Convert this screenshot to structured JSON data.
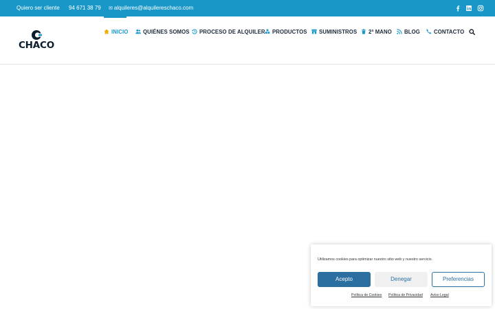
{
  "topbar": {
    "client_link": "Quiero ser cliente",
    "phone_icon": "",
    "phone": "94 671 38 79",
    "email_icon": "✉",
    "email": "alquileres@alquilereschaco.com",
    "social": [
      "facebook-icon",
      "linkedin-icon",
      "instagram-icon"
    ]
  },
  "brand": {
    "logo_text": "CHACO"
  },
  "nav": {
    "items": [
      {
        "label": "INICIO",
        "icon": "home-icon",
        "active": true
      },
      {
        "label": "QUIÉNES SOMOS",
        "icon": "users-icon"
      },
      {
        "label": "PROCESO DE ALQUILER",
        "icon": "history-icon"
      },
      {
        "label": "PRODUCTOS",
        "icon": "cubes-icon"
      },
      {
        "label": "SUMINISTROS",
        "icon": "store-icon"
      },
      {
        "label": "2ª MANO",
        "icon": "trash-icon"
      },
      {
        "label": "BLOG",
        "icon": "rss-icon"
      },
      {
        "label": "CONTACTO",
        "icon": "phone-icon"
      }
    ]
  },
  "cookie_banner": {
    "message": "Utilizamos cookies para optimizar nuestro sitio web y nuestro servicio.",
    "accept_label": "Acepto",
    "deny_label": "Denegar",
    "preferences_label": "Preferencias",
    "links": [
      "Política de Cookies",
      "Política de Privacidad",
      "Aviso Legal"
    ]
  },
  "colors": {
    "brand_blue": "#1a97c9",
    "dark_navy": "#1b2a3a",
    "accept_button": "#2a6fa0",
    "home_icon": "#f2a900"
  }
}
